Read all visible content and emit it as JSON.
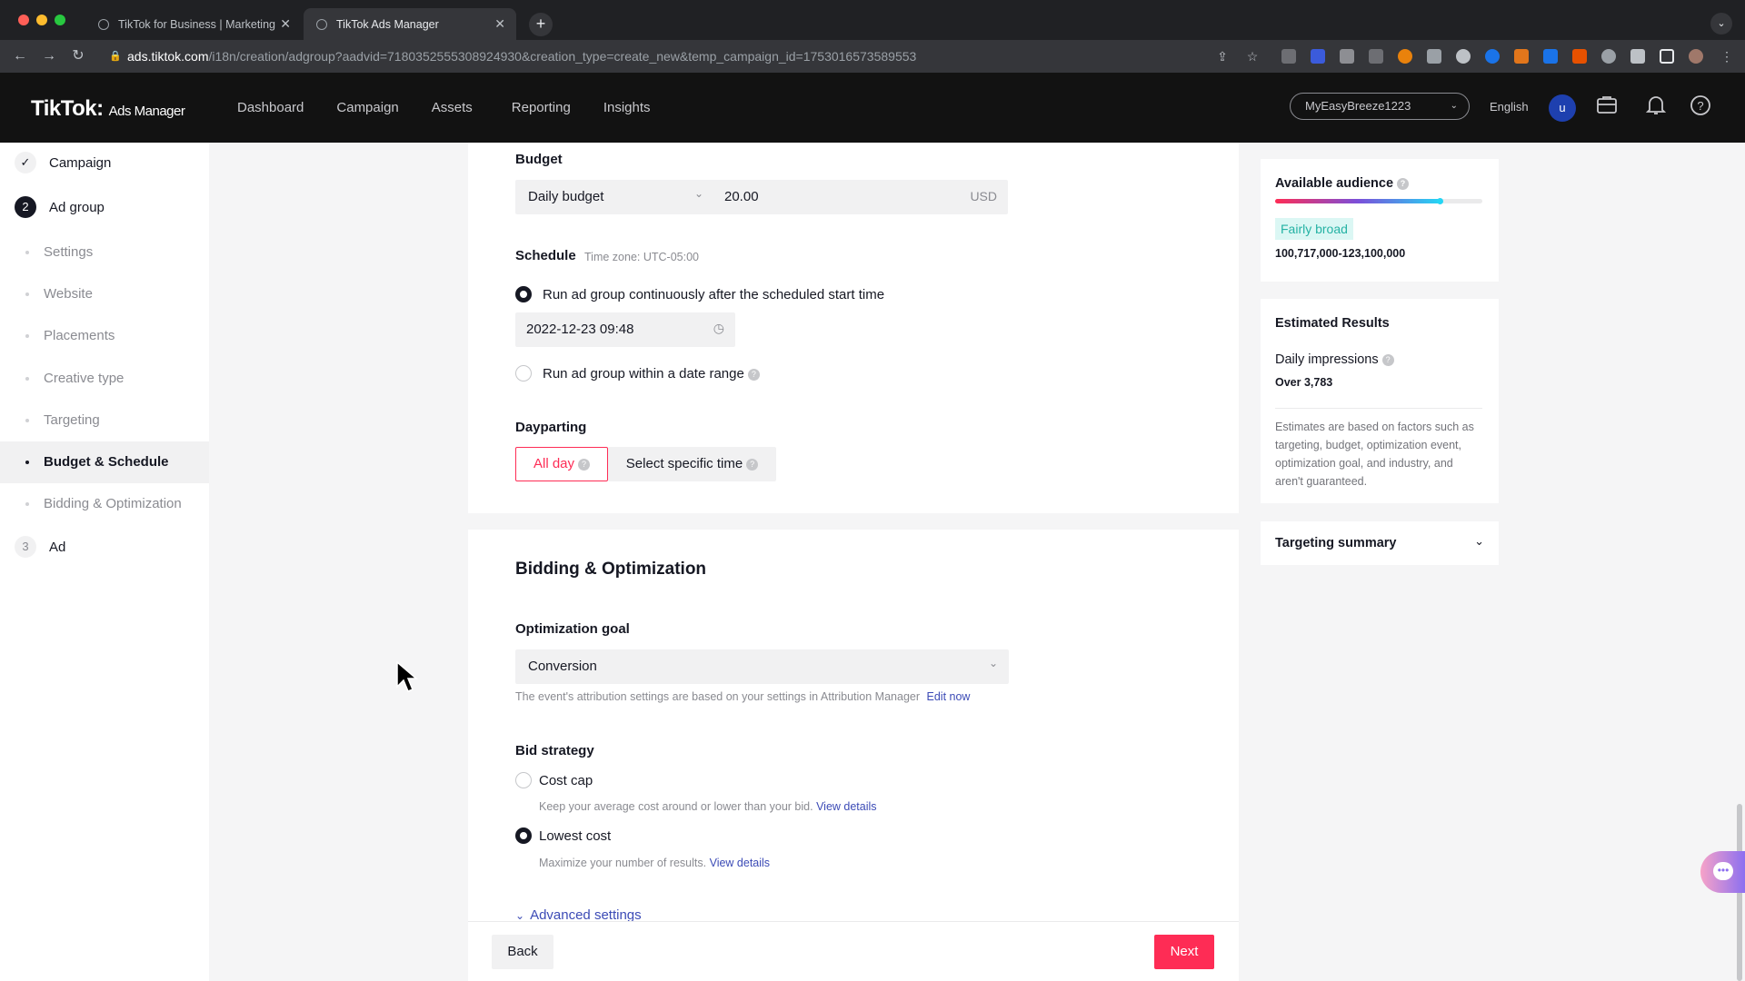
{
  "browser": {
    "tabs": [
      {
        "title": "TikTok for Business | Marketing"
      },
      {
        "title": "TikTok Ads Manager"
      }
    ],
    "url_host": "ads.tiktok.com",
    "url_path": "/i18n/creation/adgroup?aadvid=7180352555308924930&creation_type=create_new&temp_campaign_id=1753016573589553"
  },
  "header": {
    "logo": "TikTok",
    "logo_sub": "Ads Manager",
    "nav": [
      "Dashboard",
      "Campaign",
      "Assets",
      "Reporting",
      "Insights"
    ],
    "account": "MyEasyBreeze1223",
    "language": "English",
    "avatar_initial": "u"
  },
  "sidebar": {
    "campaign": "Campaign",
    "adgroup_num": "2",
    "adgroup": "Ad group",
    "items": [
      "Settings",
      "Website",
      "Placements",
      "Creative type",
      "Targeting",
      "Budget & Schedule",
      "Bidding & Optimization"
    ],
    "ad_num": "3",
    "ad": "Ad"
  },
  "budget": {
    "label": "Budget",
    "type": "Daily budget",
    "amount": "20.00",
    "currency": "USD"
  },
  "schedule": {
    "label": "Schedule",
    "timezone": "Time zone: UTC-05:00",
    "option1": "Run ad group continuously after the scheduled start time",
    "start": "2022-12-23 09:48",
    "option2": "Run ad group within a date range"
  },
  "dayparting": {
    "label": "Dayparting",
    "all_day": "All day",
    "specific": "Select specific time"
  },
  "bidding": {
    "title": "Bidding & Optimization",
    "goal_label": "Optimization goal",
    "goal": "Conversion",
    "goal_hint": "The event's attribution settings are based on your settings in Attribution Manager",
    "edit_now": "Edit now",
    "strategy_label": "Bid strategy",
    "cost_cap": "Cost cap",
    "cost_cap_hint": "Keep your average cost around or lower than your bid.",
    "lowest": "Lowest cost",
    "lowest_hint": "Maximize your number of results.",
    "view_details": "View details",
    "advanced": "Advanced settings"
  },
  "footer": {
    "back": "Back",
    "next": "Next"
  },
  "right": {
    "audience_label": "Available audience",
    "audience_level": 0.8,
    "audience_tag": "Fairly broad",
    "audience_range": "100,717,000-123,100,000",
    "est_title": "Estimated Results",
    "impr_label": "Daily impressions",
    "impr_value": "Over 3,783",
    "disclaimer": "Estimates are based on factors such as targeting, budget, optimization event, optimization goal, and industry, and aren't guaranteed.",
    "targeting_summary": "Targeting summary"
  },
  "colors": {
    "accent": "#fe2c55",
    "link": "#3c4bb6",
    "tag_bg": "#dbf7f4",
    "tag_fg": "#25b2a4"
  }
}
